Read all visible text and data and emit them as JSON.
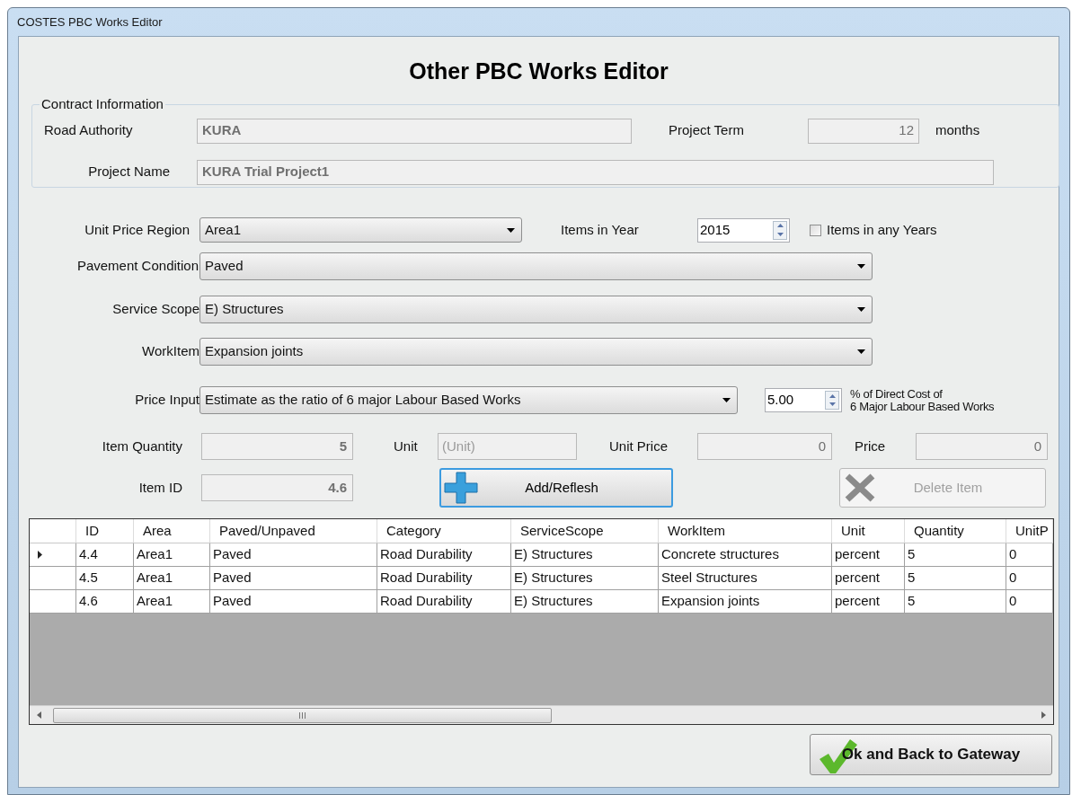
{
  "window": {
    "title": "COSTES PBC Works Editor"
  },
  "heading": "Other PBC Works Editor",
  "contract_information": {
    "legend": "Contract Information",
    "road_authority": {
      "label": "Road Authority",
      "value": "KURA",
      "disabled": true
    },
    "project_term": {
      "label": "Project Term",
      "value": "12",
      "unit": "months",
      "disabled": true
    },
    "project_name": {
      "label": "Project Name",
      "value": "KURA Trial Project1",
      "disabled": true
    }
  },
  "unit_price_region": {
    "label": "Unit Price Region",
    "value": "Area1"
  },
  "items_in_year": {
    "label": "Items in Year",
    "value": "2015"
  },
  "items_in_any_years": {
    "label": "Items in any Years",
    "checked": false
  },
  "pavement_condition": {
    "label": "Pavement Condition",
    "value": "Paved"
  },
  "service_scope": {
    "label": "Service Scope",
    "value": "E) Structures"
  },
  "work_item": {
    "label": "WorkItem",
    "value": "Expansion joints"
  },
  "price_input": {
    "label": "Price Input",
    "value": "Estimate as the ratio of 6 major Labour Based Works"
  },
  "price_ratio": {
    "value": "5.00",
    "caption": [
      "% of Direct Cost of",
      "6 Major Labour Based Works"
    ]
  },
  "item_quantity": {
    "label": "Item Quantity",
    "value": "5",
    "disabled": true
  },
  "unit": {
    "label": "Unit",
    "placeholder": "(Unit)",
    "disabled": true
  },
  "unit_price": {
    "label": "Unit Price",
    "value": "0",
    "disabled": true
  },
  "price": {
    "label": "Price",
    "value": "0",
    "disabled": true
  },
  "item_id": {
    "label": "Item ID",
    "value": "4.6",
    "disabled": true
  },
  "add_button": {
    "label": "Add/Reflesh",
    "disabled": false
  },
  "delete_button": {
    "label": "Delete Item",
    "disabled": true
  },
  "table": {
    "columns": [
      "ID",
      "Area",
      "Paved/Unpaved",
      "Category",
      "ServiceScope",
      "WorkItem",
      "Unit",
      "Quantity",
      "UnitP"
    ],
    "rows": [
      {
        "current": true,
        "cells": [
          "4.4",
          "Area1",
          "Paved",
          "Road Durability",
          "E) Structures",
          "Concrete structures",
          "percent",
          "5",
          "0"
        ]
      },
      {
        "current": false,
        "cells": [
          "4.5",
          "Area1",
          "Paved",
          "Road Durability",
          "E) Structures",
          "Steel Structures",
          "percent",
          "5",
          "0"
        ]
      },
      {
        "current": false,
        "cells": [
          "4.6",
          "Area1",
          "Paved",
          "Road Durability",
          "E) Structures",
          "Expansion joints",
          "percent",
          "5",
          "0"
        ]
      }
    ]
  },
  "ok_button": {
    "label": "Ok and Back to Gateway"
  }
}
